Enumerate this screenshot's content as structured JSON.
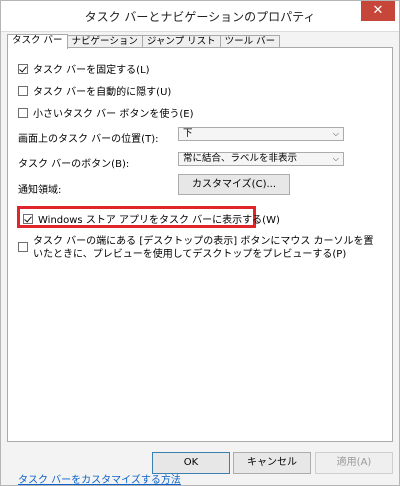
{
  "window": {
    "title": "タスク バーとナビゲーションのプロパティ",
    "close_symbol": "✕"
  },
  "tabs": [
    {
      "label": "タスク バー",
      "active": true
    },
    {
      "label": "ナビゲーション",
      "active": false
    },
    {
      "label": "ジャンプ リスト",
      "active": false
    },
    {
      "label": "ツール バー",
      "active": false
    }
  ],
  "options": {
    "lock_taskbar": {
      "label": "タスク バーを固定する(L)",
      "checked": true
    },
    "auto_hide": {
      "label": "タスク バーを自動的に隠す(U)",
      "checked": false
    },
    "small_buttons": {
      "label": "小さいタスク バー ボタンを使う(E)",
      "checked": false
    },
    "store_apps": {
      "label": "Windows ストア アプリをタスク バーに表示する(W)",
      "checked": true
    },
    "peek": {
      "label": "タスク バーの端にある [デスクトップの表示] ボタンにマウス カーソルを置いたときに、プレビューを使用してデスクトップをプレビューする(P)",
      "checked": false
    }
  },
  "settings": {
    "location_label": "画面上のタスク バーの位置(T):",
    "location_value": "下",
    "buttons_label": "タスク バーのボタン(B):",
    "buttons_value": "常に結合、ラベルを非表示",
    "notification_label": "通知領域:",
    "customize_button": "カスタマイズ(C)..."
  },
  "link": {
    "label": "タスク バーをカスタマイズする方法"
  },
  "footer": {
    "ok": "OK",
    "cancel": "キャンセル",
    "apply": "適用(A)"
  },
  "colors": {
    "highlight": "#e0262b",
    "link": "#0d62c9"
  }
}
